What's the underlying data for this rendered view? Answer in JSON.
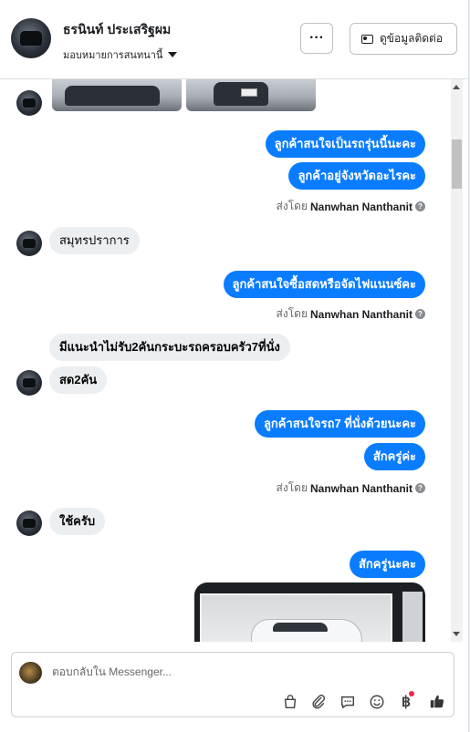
{
  "header": {
    "name": "ธรนินท์ ประเสริฐผม",
    "assign_label": "มอบหมายการสนทนานี้",
    "more_label": "···",
    "contact_label": "ดูข้อมูลติดต่อ"
  },
  "messages": [
    {
      "side": "out",
      "text": "ลูกค้าสนใจเป็นรถรุ่นนี้นะคะ"
    },
    {
      "side": "out",
      "text": "ลูกค้าอยู่จังหวัดอะไรคะ"
    },
    {
      "side": "meta",
      "prefix": "ส่งโดย",
      "sender": "Nanwhan Nanthanit"
    },
    {
      "side": "in",
      "text": "สมุทรปราการ"
    },
    {
      "side": "out",
      "text": "ลูกค้าสนใจซื้อสดหรือจัดไฟแนนซ์คะ"
    },
    {
      "side": "meta",
      "prefix": "ส่งโดย",
      "sender": "Nanwhan Nanthanit"
    },
    {
      "side": "in",
      "text": "มีแนะนำไม่รับ2คันกระบะรถครอบครัว7ที่นั่ง"
    },
    {
      "side": "in",
      "text": "สด2คัน"
    },
    {
      "side": "out",
      "text": "ลูกค้าสนใจรถ7 ที่นั่งด้วยนะคะ"
    },
    {
      "side": "out",
      "text": "สักครู่ค่ะ"
    },
    {
      "side": "meta",
      "prefix": "ส่งโดย",
      "sender": "Nanwhan Nanthanit"
    },
    {
      "side": "in",
      "text": "ใช้ครับ"
    },
    {
      "side": "out",
      "text": "สักครู่นะคะ"
    }
  ],
  "composer": {
    "placeholder": "ตอบกลับใน Messenger...",
    "tools": [
      "bag-icon",
      "paperclip-icon",
      "chat-icon",
      "emoji-icon",
      "baht-icon",
      "thumbs-up-icon"
    ],
    "accent_color": "#0a7cff"
  }
}
